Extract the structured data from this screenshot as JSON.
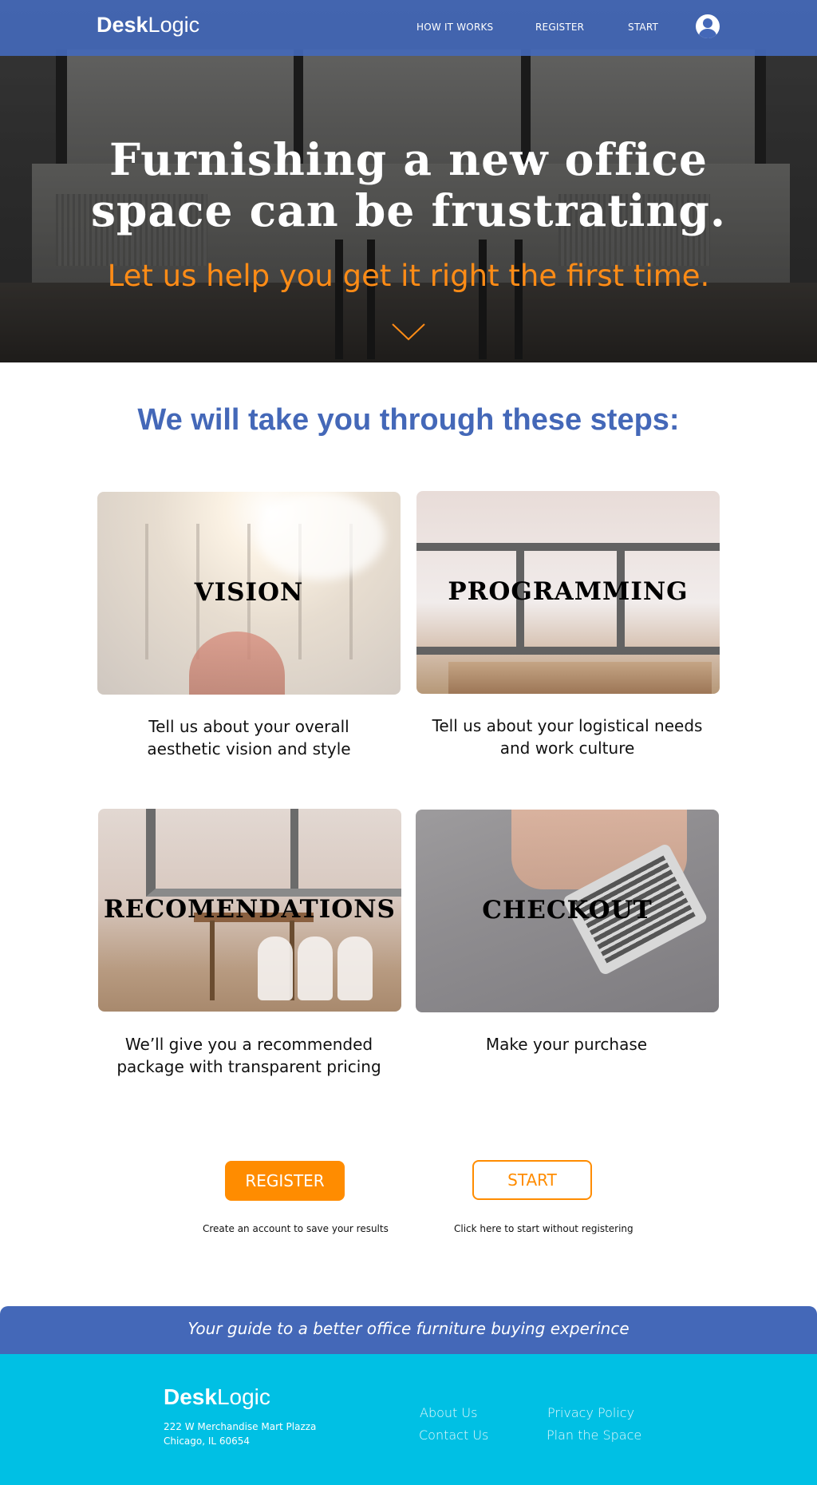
{
  "brand": {
    "bold": "Desk",
    "light": "Logic"
  },
  "nav": {
    "links": [
      "HOW IT WORKS",
      "REGISTER",
      "START"
    ]
  },
  "hero": {
    "title_line1": "Furnishing a new office",
    "title_line2": "space can be frustrating.",
    "subtitle": "Let us help you get it right the first time."
  },
  "steps": {
    "heading": "We will take you through these steps:",
    "items": [
      {
        "label": "VISION",
        "desc_line1": "Tell us about your overall",
        "desc_line2": "aesthetic vision and style"
      },
      {
        "label": "PROGRAMMING",
        "desc_line1": "Tell us about your logistical needs",
        "desc_line2": "and work culture"
      },
      {
        "label": "RECOMENDATIONS",
        "desc_line1": "We’ll give you a recommended",
        "desc_line2": "package with transparent pricing"
      },
      {
        "label": "CHECKOUT",
        "desc_line1": "Make your purchase",
        "desc_line2": ""
      }
    ]
  },
  "cta": {
    "register_label": "REGISTER",
    "register_caption": "Create an account to save your results",
    "start_label": "START",
    "start_caption": "Click here to start without registering"
  },
  "footer": {
    "tagline": "Your guide to a better office furniture buying experince",
    "address_line1": "222 W Merchandise Mart Plazza",
    "address_line2": "Chicago, IL 60654",
    "links": [
      "About Us",
      "Contact Us",
      "Privacy Policy",
      "Plan the Space"
    ]
  },
  "colors": {
    "brand_blue": "#4468b8",
    "accent_orange": "#ff8c00",
    "footer_cyan": "#00c0e4"
  },
  "icons": [
    "user-avatar-icon",
    "chevron-down-icon"
  ]
}
